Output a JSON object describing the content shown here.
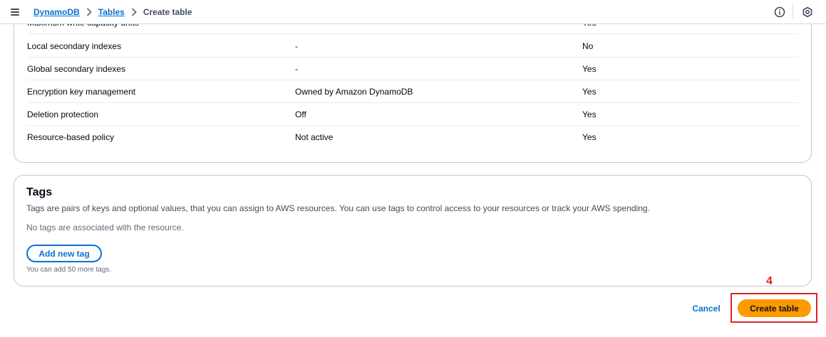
{
  "breadcrumb": {
    "item1": "DynamoDB",
    "item2": "Tables",
    "current": "Create table"
  },
  "settings_table": {
    "cut_row": {
      "label": "Maximum write capacity units",
      "value": "",
      "editable": "Yes"
    },
    "rows": [
      {
        "label": "Local secondary indexes",
        "value": "-",
        "editable": "No"
      },
      {
        "label": "Global secondary indexes",
        "value": "-",
        "editable": "Yes"
      },
      {
        "label": "Encryption key management",
        "value": "Owned by Amazon DynamoDB",
        "editable": "Yes"
      },
      {
        "label": "Deletion protection",
        "value": "Off",
        "editable": "Yes"
      },
      {
        "label": "Resource-based policy",
        "value": "Not active",
        "editable": "Yes"
      }
    ]
  },
  "tags": {
    "title": "Tags",
    "description": "Tags are pairs of keys and optional values, that you can assign to AWS resources. You can use tags to control access to your resources or track your AWS spending.",
    "empty_message": "No tags are associated with the resource.",
    "add_button": "Add new tag",
    "hint": "You can add 50 more tags."
  },
  "footer": {
    "cancel": "Cancel",
    "create": "Create table",
    "step_annotation": "4"
  },
  "colors": {
    "link": "#0972d3",
    "primary_button": "#ff9900",
    "annotation": "#e02424"
  }
}
